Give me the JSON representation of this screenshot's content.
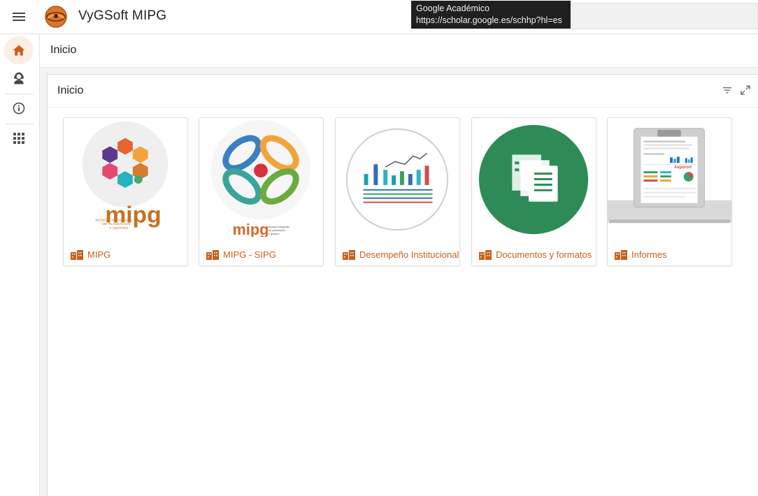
{
  "app": {
    "title": "VyGSoft MIPG"
  },
  "tooltip": {
    "line1": "Google Académico",
    "line2": "https://scholar.google.es/schhp?hl=es"
  },
  "breadcrumb": {
    "title": "Inicio"
  },
  "panel": {
    "title": "Inicio"
  },
  "sidebar": {
    "items": [
      {
        "name": "home-icon",
        "active": true
      },
      {
        "name": "user-support-icon",
        "active": false
      },
      {
        "name": "info-icon",
        "active": false
      },
      {
        "name": "apps-grid-icon",
        "active": false
      }
    ]
  },
  "cards": [
    {
      "label": "MIPG",
      "icon": "building-icon"
    },
    {
      "label": "MIPG - SIPG",
      "icon": "building-icon"
    },
    {
      "label": "Desempeño Institucional",
      "icon": "building-icon"
    },
    {
      "label": "Documentos y formatos",
      "icon": "building-icon"
    },
    {
      "label": "Informes",
      "icon": "building-icon"
    }
  ],
  "card_images": {
    "mipg_word": "mipg",
    "mipg_caption_1": "MODELO INTEGRADO",
    "mipg_caption_2": "DE PLANEACIÓN",
    "mipg_caption_3": "Y GESTIÓN",
    "sipg_word": "mipg",
    "sipg_caption_1": "modelo integrado",
    "sipg_caption_2": "de planeación",
    "sipg_caption_3": "y gestión",
    "report_word": "Aeporort"
  },
  "colors": {
    "accent": "#c5611b",
    "home_active_bg": "#fdeee3",
    "tooltip_bg": "#1f1f1f",
    "documents_green": "#2e8b57"
  }
}
